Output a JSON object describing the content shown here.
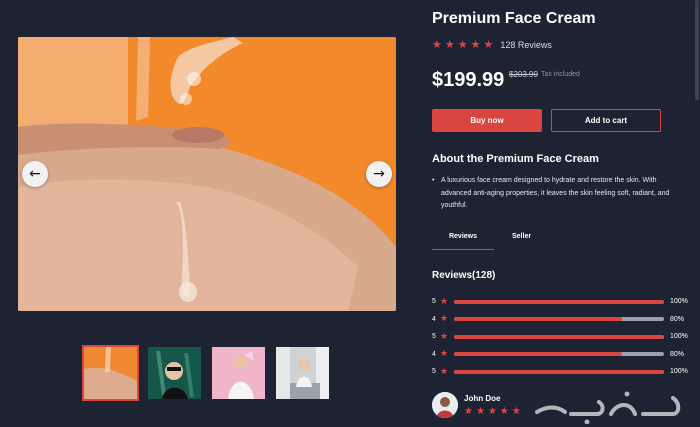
{
  "product": {
    "title": "Premium Face Cream",
    "reviews_count_label": "128 Reviews",
    "rating": 5,
    "price": "$199.99",
    "old_price": "$203.99",
    "tax_note": "Tax included"
  },
  "actions": {
    "buy_label": "Buy now",
    "cart_label": "Add to cart"
  },
  "gallery": {
    "prev_icon": "arrow-left-icon",
    "next_icon": "arrow-right-icon",
    "thumbnails": 4,
    "active_index": 0
  },
  "about": {
    "title": "About the Premium Face Cream",
    "items": [
      "A luxurious face cream designed to hydrate and restore the skin. With advanced anti-aging properties, it leaves the skin feeling soft, radiant, and youthful."
    ]
  },
  "tabs": [
    {
      "label": "Reviews",
      "active": true
    },
    {
      "label": "Seller",
      "active": false
    }
  ],
  "reviews": {
    "heading": "Reviews(128)",
    "breakdown": [
      {
        "stars": "5",
        "fill": 1.0,
        "pct": "100%"
      },
      {
        "stars": "4",
        "fill": 0.8,
        "pct": "80%"
      },
      {
        "stars": "5",
        "fill": 1.0,
        "pct": "100%"
      },
      {
        "stars": "4",
        "fill": 0.8,
        "pct": "80%"
      },
      {
        "stars": "5",
        "fill": 1.0,
        "pct": "100%"
      }
    ],
    "first_reviewer": {
      "name": "John Doe",
      "stars": 5
    }
  },
  "colors": {
    "accent": "#d9453f",
    "background": "#1d2333",
    "track": "#9aa1ae"
  }
}
